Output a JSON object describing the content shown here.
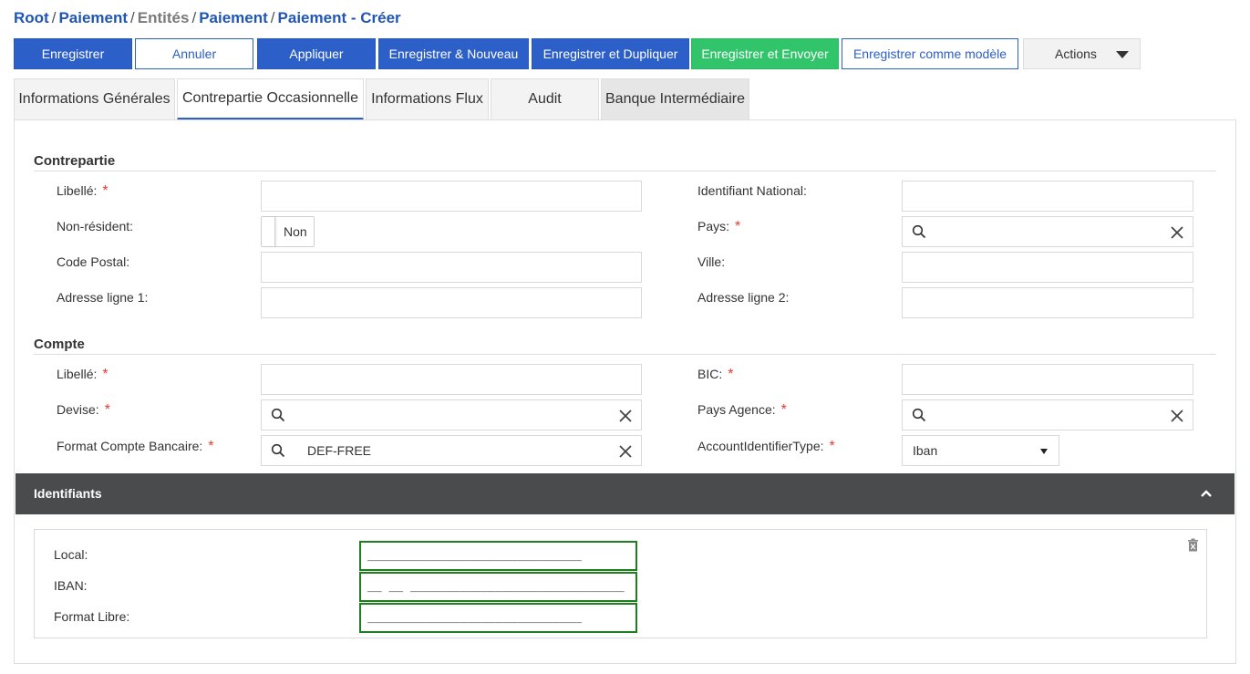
{
  "breadcrumb": {
    "items": [
      {
        "label": "Root",
        "style": "link"
      },
      {
        "label": "Paiement",
        "style": "link"
      },
      {
        "label": "Entités",
        "style": "muted"
      },
      {
        "label": "Paiement",
        "style": "link"
      },
      {
        "label": "Paiement - Créer",
        "style": "link"
      }
    ],
    "separator": "/"
  },
  "toolbar": {
    "save": "Enregistrer",
    "cancel": "Annuler",
    "apply": "Appliquer",
    "save_new": "Enregistrer & Nouveau",
    "save_duplicate": "Enregistrer et Dupliquer",
    "save_send": "Enregistrer et Envoyer",
    "save_template": "Enregistrer comme modèle",
    "actions": "Actions"
  },
  "tabs": {
    "general": "Informations Générales",
    "counterparty": "Contrepartie Occasionnelle",
    "flow": "Informations Flux",
    "audit": "Audit",
    "bank": "Banque Intermédiaire"
  },
  "contrepartie": {
    "title": "Contrepartie",
    "libelle_label": "Libellé:",
    "libelle_value": "",
    "id_national_label": "Identifiant National:",
    "id_national_value": "",
    "non_resident_label": "Non-résident:",
    "non_resident_value": "Non",
    "pays_label": "Pays:",
    "pays_value": "",
    "code_postal_label": "Code Postal:",
    "code_postal_value": "",
    "ville_label": "Ville:",
    "ville_value": "",
    "adresse1_label": "Adresse ligne 1:",
    "adresse1_value": "",
    "adresse2_label": "Adresse ligne 2:",
    "adresse2_value": ""
  },
  "compte": {
    "title": "Compte",
    "libelle_label": "Libellé:",
    "libelle_value": "",
    "bic_label": "BIC:",
    "bic_value": "",
    "devise_label": "Devise:",
    "devise_value": "",
    "pays_agence_label": "Pays Agence:",
    "pays_agence_value": "",
    "format_label": "Format Compte Bancaire:",
    "format_value": "DEF-FREE",
    "account_id_type_label": "AccountIdentifierType:",
    "account_id_type_value": "Iban"
  },
  "required_marker": "*",
  "identifiants": {
    "title": "Identifiants",
    "local_label": "Local:",
    "local_mask": "______________________________",
    "iban_label": "IBAN:",
    "iban_mask": "__ __ ______________________________",
    "libre_label": "Format Libre:",
    "libre_mask": "______________________________"
  },
  "colors": {
    "primary": "#2c5fc7",
    "success": "#31c46b",
    "required": "#e53b2f",
    "band": "#4a4b4d",
    "valid_border": "#1d7f1d"
  }
}
